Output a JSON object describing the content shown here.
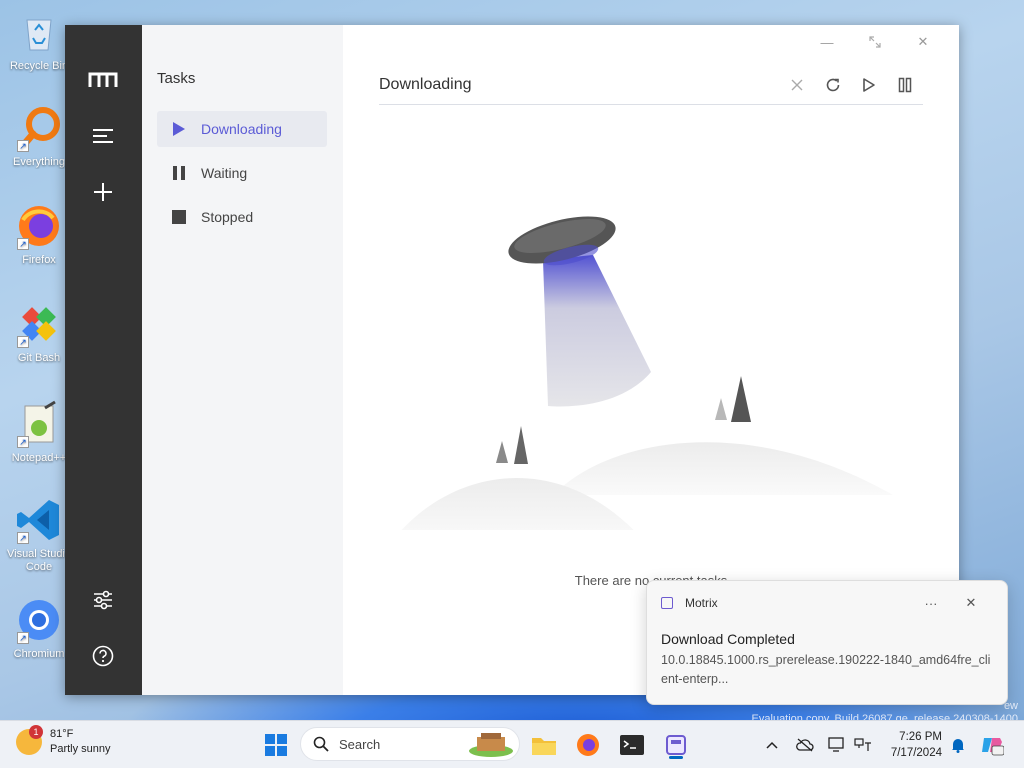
{
  "desktop": {
    "icons": [
      {
        "label": "Recycle Bin"
      },
      {
        "label": "Everything"
      },
      {
        "label": "Firefox"
      },
      {
        "label": "Git Bash"
      },
      {
        "label": "Notepad++"
      },
      {
        "label": "Visual Studio Code"
      },
      {
        "label": "Chromium"
      }
    ],
    "watermark_line1": "ew",
    "watermark_line2": "Evaluation copy. Build 26087.ge_release.240308-1400"
  },
  "app": {
    "sidebar": {
      "title": "Tasks",
      "items": [
        {
          "label": "Downloading",
          "active": true
        },
        {
          "label": "Waiting",
          "active": false
        },
        {
          "label": "Stopped",
          "active": false
        }
      ]
    },
    "main": {
      "title": "Downloading",
      "empty_text": "There are no current tasks"
    },
    "accent_color": "#5b5bd6"
  },
  "toast": {
    "app_name": "Motrix",
    "more_label": "···",
    "title": "Download Completed",
    "body": "10.0.18845.1000.rs_prerelease.190222-1840_amd64fre_client-enterp..."
  },
  "taskbar": {
    "weather": {
      "temp": "81°F",
      "condition": "Partly sunny",
      "badge": "1"
    },
    "search_placeholder": "Search",
    "time": "7:26 PM",
    "date": "7/17/2024"
  }
}
